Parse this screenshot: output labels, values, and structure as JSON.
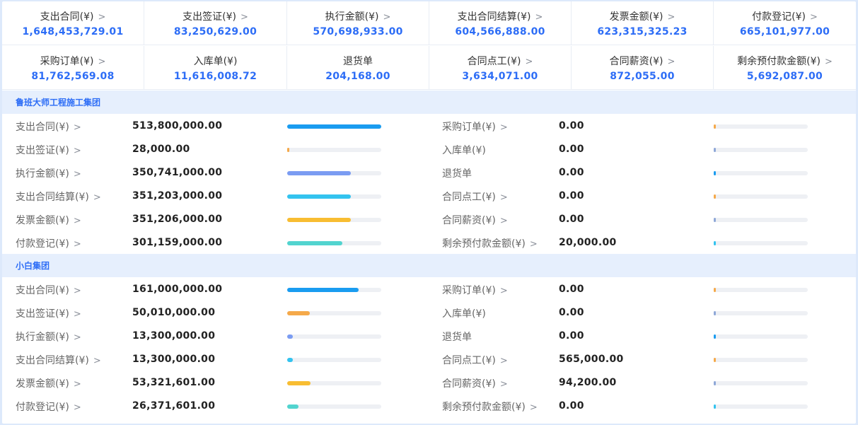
{
  "summary": [
    {
      "label": "支出合同(¥)",
      "value": "1,648,453,729.01",
      "chevron": true
    },
    {
      "label": "支出签证(¥)",
      "value": "83,250,629.00",
      "chevron": true
    },
    {
      "label": "执行金额(¥)",
      "value": "570,698,933.00",
      "chevron": true
    },
    {
      "label": "支出合同结算(¥)",
      "value": "604,566,888.00",
      "chevron": true
    },
    {
      "label": "发票金额(¥)",
      "value": "623,315,325.23",
      "chevron": true
    },
    {
      "label": "付款登记(¥)",
      "value": "665,101,977.00",
      "chevron": true
    },
    {
      "label": "采购订单(¥)",
      "value": "81,762,569.08",
      "chevron": true
    },
    {
      "label": "入库单(¥)",
      "value": "11,616,008.72",
      "chevron": false
    },
    {
      "label": "退货单",
      "value": "204,168.00",
      "chevron": false
    },
    {
      "label": "合同点工(¥)",
      "value": "3,634,071.00",
      "chevron": true
    },
    {
      "label": "合同薪资(¥)",
      "value": "872,055.00",
      "chevron": true
    },
    {
      "label": "剩余预付款金额(¥)",
      "value": "5,692,087.00",
      "chevron": true
    }
  ],
  "chevron_glyph": ">",
  "groups": [
    {
      "name": "鲁班大师工程施工集团",
      "rows": [
        {
          "left": {
            "label": "支出合同(¥)",
            "chevron": true,
            "value": "513,800,000.00",
            "fill": 1.0,
            "color": "#1a9cf0"
          },
          "right": {
            "label": "采购订单(¥)",
            "chevron": true,
            "value": "0.00",
            "fill": 0,
            "color": "#f5a94a"
          }
        },
        {
          "left": {
            "label": "支出签证(¥)",
            "chevron": true,
            "value": "28,000.00",
            "fill": 0,
            "color": "#f5a94a"
          },
          "right": {
            "label": "入库单(¥)",
            "chevron": false,
            "value": "0.00",
            "fill": 0,
            "color": "#8fa8d8"
          }
        },
        {
          "left": {
            "label": "执行金额(¥)",
            "chevron": true,
            "value": "350,741,000.00",
            "fill": 0.68,
            "color": "#7b9cf2"
          },
          "right": {
            "label": "退货单",
            "chevron": false,
            "value": "0.00",
            "fill": 0,
            "color": "#1a9cf0"
          }
        },
        {
          "left": {
            "label": "支出合同结算(¥)",
            "chevron": true,
            "value": "351,203,000.00",
            "fill": 0.68,
            "color": "#33c3ef"
          },
          "right": {
            "label": "合同点工(¥)",
            "chevron": true,
            "value": "0.00",
            "fill": 0,
            "color": "#f5a94a"
          }
        },
        {
          "left": {
            "label": "发票金额(¥)",
            "chevron": true,
            "value": "351,206,000.00",
            "fill": 0.68,
            "color": "#f8bd32"
          },
          "right": {
            "label": "合同薪资(¥)",
            "chevron": true,
            "value": "0.00",
            "fill": 0,
            "color": "#8fa8d8"
          }
        },
        {
          "left": {
            "label": "付款登记(¥)",
            "chevron": true,
            "value": "301,159,000.00",
            "fill": 0.59,
            "color": "#52d4cf"
          },
          "right": {
            "label": "剩余预付款金额(¥)",
            "chevron": true,
            "value": "20,000.00",
            "fill": 0,
            "color": "#33c3ef"
          }
        }
      ]
    },
    {
      "name": "小白集团",
      "rows": [
        {
          "left": {
            "label": "支出合同(¥)",
            "chevron": true,
            "value": "161,000,000.00",
            "fill": 0.76,
            "color": "#1a9cf0"
          },
          "right": {
            "label": "采购订单(¥)",
            "chevron": true,
            "value": "0.00",
            "fill": 0,
            "color": "#f5a94a"
          }
        },
        {
          "left": {
            "label": "支出签证(¥)",
            "chevron": true,
            "value": "50,010,000.00",
            "fill": 0.24,
            "color": "#f5a94a"
          },
          "right": {
            "label": "入库单(¥)",
            "chevron": false,
            "value": "0.00",
            "fill": 0,
            "color": "#8fa8d8"
          }
        },
        {
          "left": {
            "label": "执行金额(¥)",
            "chevron": true,
            "value": "13,300,000.00",
            "fill": 0.06,
            "color": "#7b9cf2"
          },
          "right": {
            "label": "退货单",
            "chevron": false,
            "value": "0.00",
            "fill": 0,
            "color": "#1a9cf0"
          }
        },
        {
          "left": {
            "label": "支出合同结算(¥)",
            "chevron": true,
            "value": "13,300,000.00",
            "fill": 0.06,
            "color": "#33c3ef"
          },
          "right": {
            "label": "合同点工(¥)",
            "chevron": true,
            "value": "565,000.00",
            "fill": 0,
            "color": "#f5a94a"
          }
        },
        {
          "left": {
            "label": "发票金额(¥)",
            "chevron": true,
            "value": "53,321,601.00",
            "fill": 0.25,
            "color": "#f8bd32"
          },
          "right": {
            "label": "合同薪资(¥)",
            "chevron": true,
            "value": "94,200.00",
            "fill": 0,
            "color": "#8fa8d8"
          }
        },
        {
          "left": {
            "label": "付款登记(¥)",
            "chevron": true,
            "value": "26,371,601.00",
            "fill": 0.12,
            "color": "#52d4cf"
          },
          "right": {
            "label": "剩余预付款金额(¥)",
            "chevron": true,
            "value": "0.00",
            "fill": 0,
            "color": "#33c3ef"
          }
        }
      ]
    }
  ]
}
